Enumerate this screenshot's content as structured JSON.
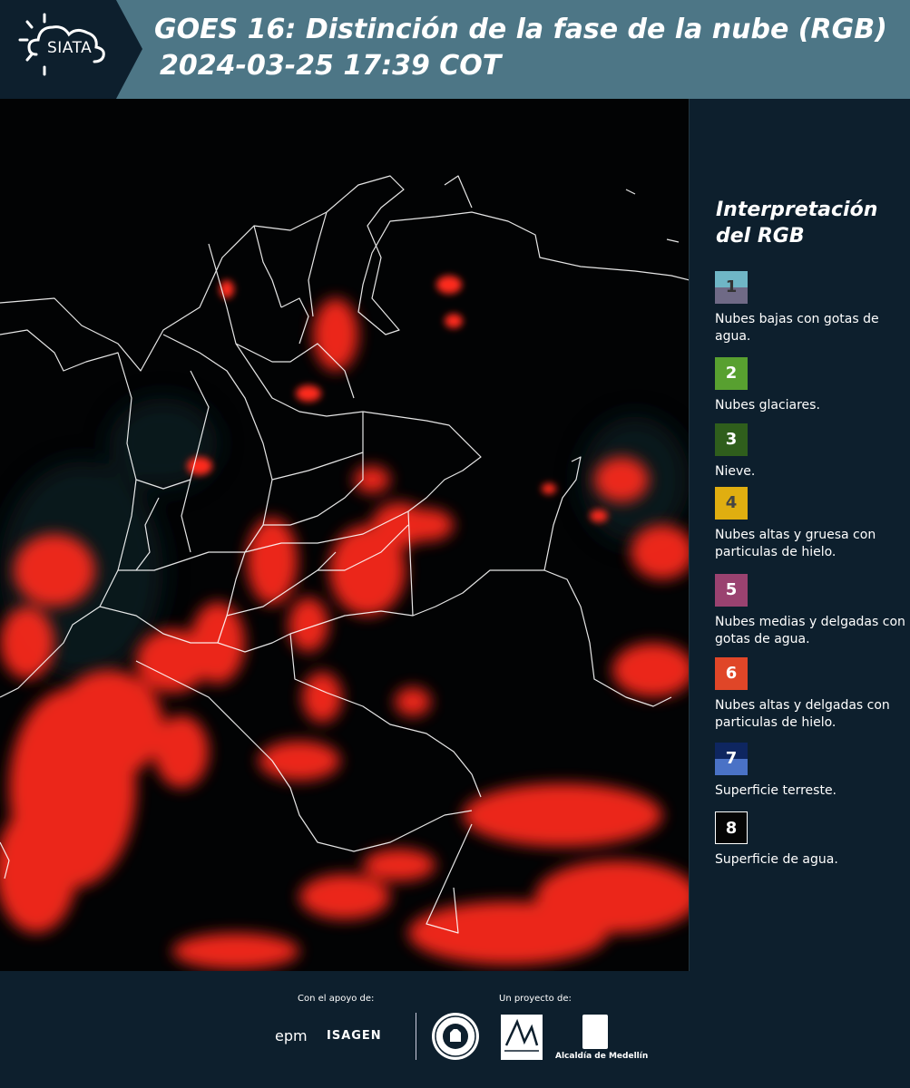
{
  "header": {
    "logo_text": "SIATA",
    "title": "GOES 16: Distinción de la fase de la nube (RGB)",
    "subtitle": "2024-03-25 17:39 COT"
  },
  "legend": {
    "title": "Interpretación del RGB",
    "items": [
      {
        "number": "1",
        "label": "Nubes bajas con gotas de agua.",
        "color_top": "#6fb6c6",
        "color_bottom": "#6f6a86"
      },
      {
        "number": "2",
        "label": "Nubes glaciares.",
        "color": "#58a030"
      },
      {
        "number": "3",
        "label": "Nieve.",
        "color": "#2f5e1c"
      },
      {
        "number": "4",
        "label": "Nubes altas y gruesa con particulas de hielo.",
        "color": "#e0ae10"
      },
      {
        "number": "5",
        "label": "Nubes medias y delgadas con gotas de agua.",
        "color": "#9a4270"
      },
      {
        "number": "6",
        "label": "Nubes altas y delgadas con particulas de hielo.",
        "color": "#e04628"
      },
      {
        "number": "7",
        "label": "Superficie terreste.",
        "color_top": "#0e2660",
        "color_bottom": "#4a72c6"
      },
      {
        "number": "8",
        "label": "Superficie de agua.",
        "color": "#050505"
      }
    ]
  },
  "footer": {
    "support_label": "Con el apoyo de:",
    "project_label": "Un proyecto de:",
    "sponsor_1": "epm",
    "sponsor_2": "ISAGEN",
    "partner_3": "Alcaldía de Medellín"
  },
  "colors": {
    "header_bg": "#4d7686",
    "logo_bg": "#0d1f2d",
    "panel_bg": "#0d1f2d",
    "cloud_red": "#ff2a1a"
  }
}
